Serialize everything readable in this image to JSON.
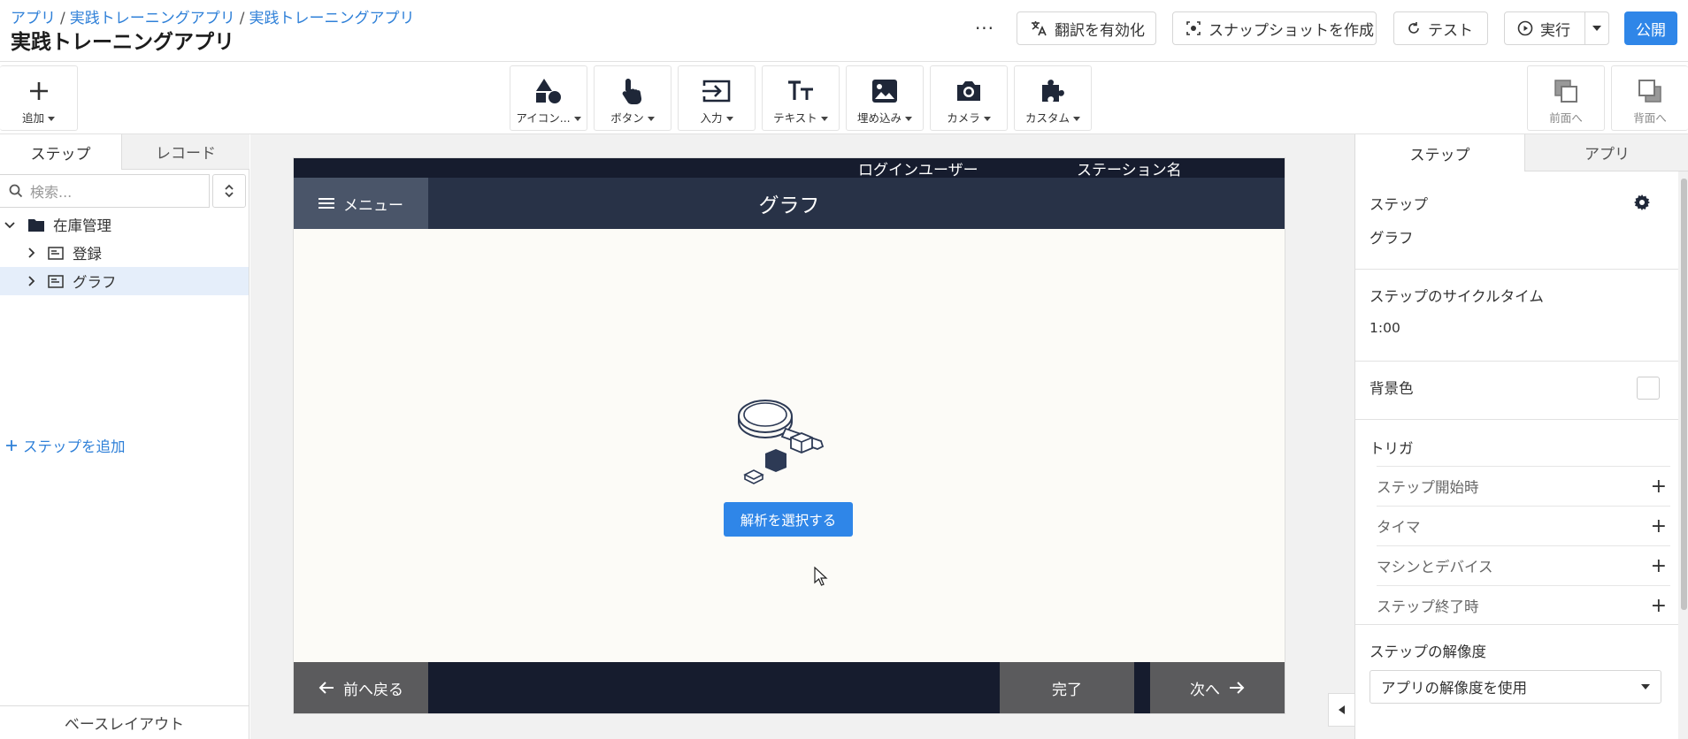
{
  "header": {
    "breadcrumb": [
      "アプリ",
      "実践トレーニングアプリ",
      "実践トレーニングアプリ"
    ],
    "app_title": "実践トレーニングアプリ",
    "more_label": "···",
    "translate_label": "翻訳を有効化",
    "snapshot_label": "スナップショットを作成",
    "test_label": "テスト",
    "run_label": "実行",
    "publish_label": "公開"
  },
  "toolbar": {
    "add_label": "追加",
    "items": [
      "アイコン...",
      "ボタン",
      "入力",
      "テキスト",
      "埋め込み",
      "カメラ",
      "カスタム"
    ],
    "bring_forward_label": "前面へ",
    "send_backward_label": "背面へ"
  },
  "left_panel": {
    "tab_steps": "ステップ",
    "tab_records": "レコード",
    "search_placeholder": "検索...",
    "tree": {
      "folder": "在庫管理",
      "items": [
        "登録",
        "グラフ"
      ]
    },
    "add_step_label": "ステップを追加",
    "base_layout_label": "ベースレイアウト"
  },
  "canvas": {
    "status_user": "ログインユーザー",
    "status_station": "ステーション名",
    "menu_label": "メニュー",
    "screen_title": "グラフ",
    "analysis_button_label": "解析を選択する",
    "back_label": "前へ戻る",
    "complete_label": "完了",
    "next_label": "次へ"
  },
  "right_panel": {
    "tab_step": "ステップ",
    "tab_app": "アプリ",
    "step_label": "ステップ",
    "step_value": "グラフ",
    "cycle_time_label": "ステップのサイクルタイム",
    "cycle_time_value": "1:00",
    "background_label": "背景色",
    "triggers_label": "トリガ",
    "triggers": [
      "ステップ開始時",
      "タイマ",
      "マシンとデバイス",
      "ステップ終了時"
    ],
    "resolution_label": "ステップの解像度",
    "resolution_value": "アプリの解像度を使用"
  },
  "colors": {
    "accent": "#2f86e8",
    "link": "#2f80d8",
    "dark_bar": "#161c2e",
    "title_bar": "#283247",
    "menu_button": "#4a5569",
    "footer_button": "#5b5b5d",
    "selected_row": "#e5eefa"
  }
}
